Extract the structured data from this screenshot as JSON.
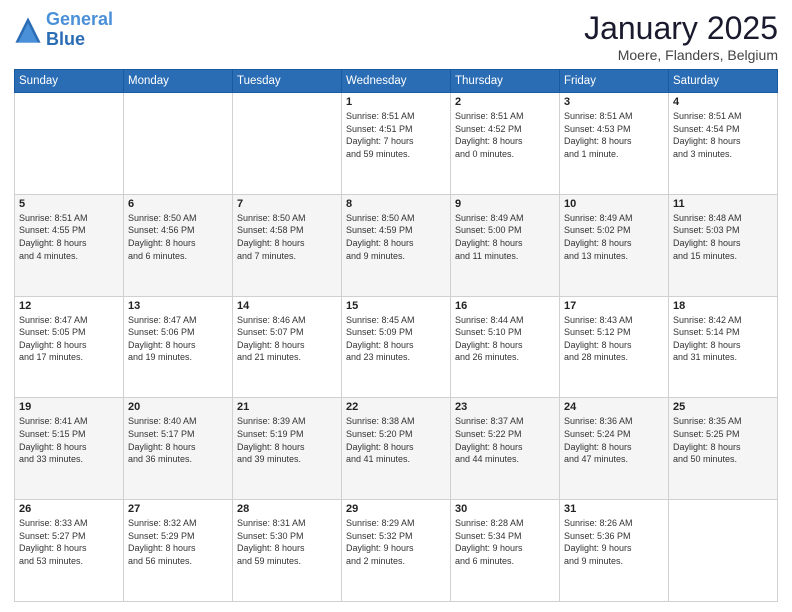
{
  "logo": {
    "line1": "General",
    "line2": "Blue"
  },
  "calendar": {
    "title": "January 2025",
    "subtitle": "Moere, Flanders, Belgium",
    "weekdays": [
      "Sunday",
      "Monday",
      "Tuesday",
      "Wednesday",
      "Thursday",
      "Friday",
      "Saturday"
    ],
    "weeks": [
      [
        {
          "num": "",
          "info": ""
        },
        {
          "num": "",
          "info": ""
        },
        {
          "num": "",
          "info": ""
        },
        {
          "num": "1",
          "info": "Sunrise: 8:51 AM\nSunset: 4:51 PM\nDaylight: 7 hours\nand 59 minutes."
        },
        {
          "num": "2",
          "info": "Sunrise: 8:51 AM\nSunset: 4:52 PM\nDaylight: 8 hours\nand 0 minutes."
        },
        {
          "num": "3",
          "info": "Sunrise: 8:51 AM\nSunset: 4:53 PM\nDaylight: 8 hours\nand 1 minute."
        },
        {
          "num": "4",
          "info": "Sunrise: 8:51 AM\nSunset: 4:54 PM\nDaylight: 8 hours\nand 3 minutes."
        }
      ],
      [
        {
          "num": "5",
          "info": "Sunrise: 8:51 AM\nSunset: 4:55 PM\nDaylight: 8 hours\nand 4 minutes."
        },
        {
          "num": "6",
          "info": "Sunrise: 8:50 AM\nSunset: 4:56 PM\nDaylight: 8 hours\nand 6 minutes."
        },
        {
          "num": "7",
          "info": "Sunrise: 8:50 AM\nSunset: 4:58 PM\nDaylight: 8 hours\nand 7 minutes."
        },
        {
          "num": "8",
          "info": "Sunrise: 8:50 AM\nSunset: 4:59 PM\nDaylight: 8 hours\nand 9 minutes."
        },
        {
          "num": "9",
          "info": "Sunrise: 8:49 AM\nSunset: 5:00 PM\nDaylight: 8 hours\nand 11 minutes."
        },
        {
          "num": "10",
          "info": "Sunrise: 8:49 AM\nSunset: 5:02 PM\nDaylight: 8 hours\nand 13 minutes."
        },
        {
          "num": "11",
          "info": "Sunrise: 8:48 AM\nSunset: 5:03 PM\nDaylight: 8 hours\nand 15 minutes."
        }
      ],
      [
        {
          "num": "12",
          "info": "Sunrise: 8:47 AM\nSunset: 5:05 PM\nDaylight: 8 hours\nand 17 minutes."
        },
        {
          "num": "13",
          "info": "Sunrise: 8:47 AM\nSunset: 5:06 PM\nDaylight: 8 hours\nand 19 minutes."
        },
        {
          "num": "14",
          "info": "Sunrise: 8:46 AM\nSunset: 5:07 PM\nDaylight: 8 hours\nand 21 minutes."
        },
        {
          "num": "15",
          "info": "Sunrise: 8:45 AM\nSunset: 5:09 PM\nDaylight: 8 hours\nand 23 minutes."
        },
        {
          "num": "16",
          "info": "Sunrise: 8:44 AM\nSunset: 5:10 PM\nDaylight: 8 hours\nand 26 minutes."
        },
        {
          "num": "17",
          "info": "Sunrise: 8:43 AM\nSunset: 5:12 PM\nDaylight: 8 hours\nand 28 minutes."
        },
        {
          "num": "18",
          "info": "Sunrise: 8:42 AM\nSunset: 5:14 PM\nDaylight: 8 hours\nand 31 minutes."
        }
      ],
      [
        {
          "num": "19",
          "info": "Sunrise: 8:41 AM\nSunset: 5:15 PM\nDaylight: 8 hours\nand 33 minutes."
        },
        {
          "num": "20",
          "info": "Sunrise: 8:40 AM\nSunset: 5:17 PM\nDaylight: 8 hours\nand 36 minutes."
        },
        {
          "num": "21",
          "info": "Sunrise: 8:39 AM\nSunset: 5:19 PM\nDaylight: 8 hours\nand 39 minutes."
        },
        {
          "num": "22",
          "info": "Sunrise: 8:38 AM\nSunset: 5:20 PM\nDaylight: 8 hours\nand 41 minutes."
        },
        {
          "num": "23",
          "info": "Sunrise: 8:37 AM\nSunset: 5:22 PM\nDaylight: 8 hours\nand 44 minutes."
        },
        {
          "num": "24",
          "info": "Sunrise: 8:36 AM\nSunset: 5:24 PM\nDaylight: 8 hours\nand 47 minutes."
        },
        {
          "num": "25",
          "info": "Sunrise: 8:35 AM\nSunset: 5:25 PM\nDaylight: 8 hours\nand 50 minutes."
        }
      ],
      [
        {
          "num": "26",
          "info": "Sunrise: 8:33 AM\nSunset: 5:27 PM\nDaylight: 8 hours\nand 53 minutes."
        },
        {
          "num": "27",
          "info": "Sunrise: 8:32 AM\nSunset: 5:29 PM\nDaylight: 8 hours\nand 56 minutes."
        },
        {
          "num": "28",
          "info": "Sunrise: 8:31 AM\nSunset: 5:30 PM\nDaylight: 8 hours\nand 59 minutes."
        },
        {
          "num": "29",
          "info": "Sunrise: 8:29 AM\nSunset: 5:32 PM\nDaylight: 9 hours\nand 2 minutes."
        },
        {
          "num": "30",
          "info": "Sunrise: 8:28 AM\nSunset: 5:34 PM\nDaylight: 9 hours\nand 6 minutes."
        },
        {
          "num": "31",
          "info": "Sunrise: 8:26 AM\nSunset: 5:36 PM\nDaylight: 9 hours\nand 9 minutes."
        },
        {
          "num": "",
          "info": ""
        }
      ]
    ]
  }
}
